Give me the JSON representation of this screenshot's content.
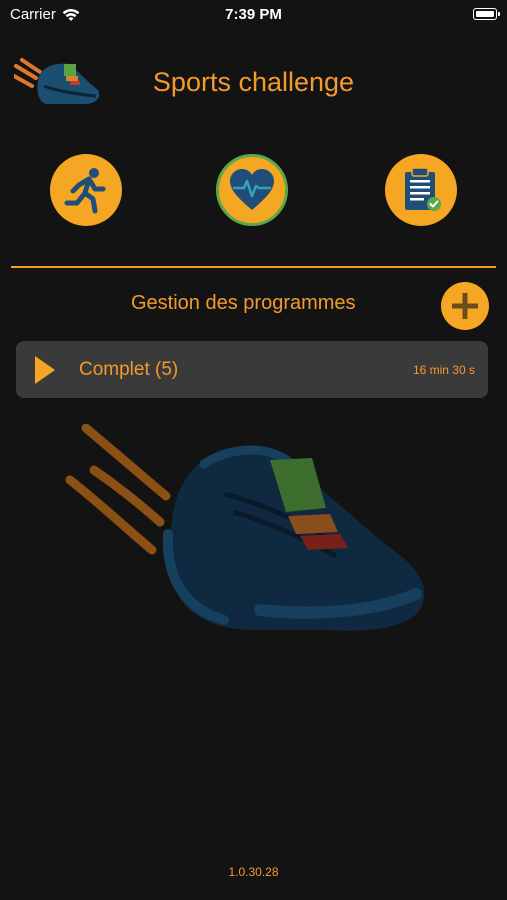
{
  "status_bar": {
    "carrier": "Carrier",
    "time": "7:39 PM"
  },
  "header": {
    "title": "Sports challenge",
    "logo_icon": "running-shoe-logo"
  },
  "nav": {
    "buttons": [
      {
        "icon": "runner-icon",
        "active": false
      },
      {
        "icon": "heart-pulse-icon",
        "active": true
      },
      {
        "icon": "clipboard-check-icon",
        "active": false
      }
    ]
  },
  "programs": {
    "section_title": "Gestion des programmes",
    "add_icon": "plus-icon",
    "items": [
      {
        "name": "Complet (5)",
        "duration": "16 min 30 s"
      }
    ]
  },
  "footer": {
    "version": "1.0.30.28"
  },
  "colors": {
    "accent": "#f39a2b",
    "button_fill": "#f5a623",
    "icon_blue": "#1f4e79",
    "active_ring": "#5aa84a",
    "row_bg": "#3b3a3b",
    "background": "#141314"
  }
}
